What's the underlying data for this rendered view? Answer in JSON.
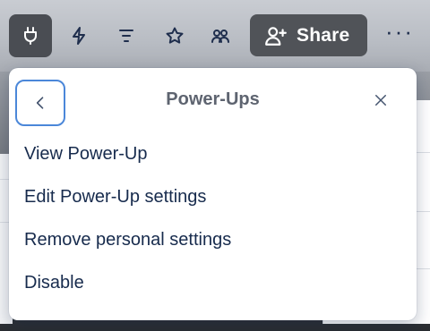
{
  "toolbar": {
    "buttons": [
      {
        "name": "power-ups",
        "icon": "plug-icon",
        "active": true
      },
      {
        "name": "automation",
        "icon": "lightning-bolt-icon",
        "active": false
      },
      {
        "name": "filters",
        "icon": "filter-lines-icon",
        "active": false
      },
      {
        "name": "star",
        "icon": "star-icon",
        "active": false
      },
      {
        "name": "members",
        "icon": "people-icon",
        "active": false
      }
    ],
    "share_label": "Share",
    "share_icon": "user-plus-icon",
    "more_label": "···"
  },
  "popover": {
    "title": "Power-Ups",
    "back_icon": "chevron-left-icon",
    "close_icon": "close-icon",
    "items": [
      {
        "label": "View Power-Up"
      },
      {
        "label": "Edit Power-Up settings"
      },
      {
        "label": "Remove personal settings"
      },
      {
        "label": "Disable"
      }
    ]
  },
  "colors": {
    "active_button_bg": "#4a4d53",
    "share_button_bg": "#505358",
    "focus_ring": "#4b87d9",
    "menu_text": "#172b4d",
    "title_text": "#5e6470"
  }
}
